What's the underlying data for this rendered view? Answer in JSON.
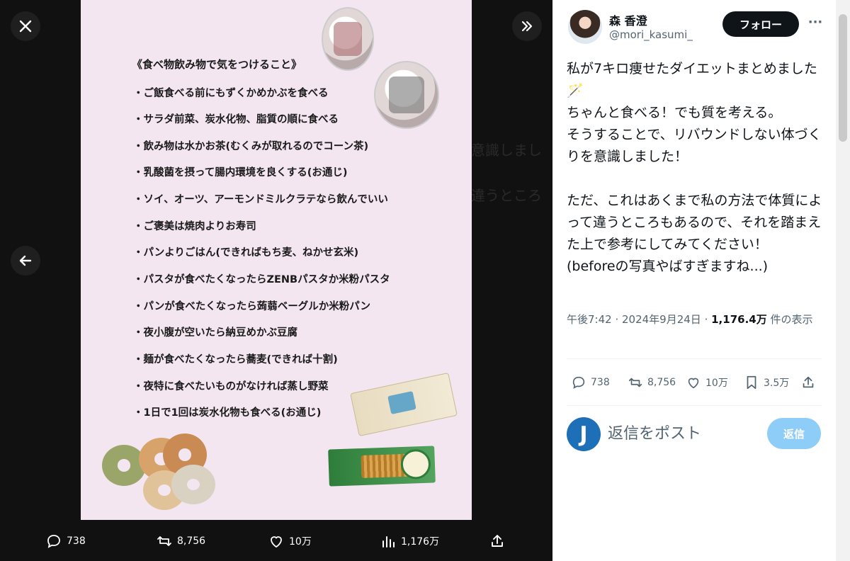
{
  "viewer": {
    "close_icon": "close-icon",
    "expand_icon": "double-chevron-right-icon",
    "prev_icon": "arrow-left-icon",
    "background_ghost": [
      "意識しまし",
      "違うところ"
    ],
    "media": {
      "heading": "《食べ物飲み物で気をつけること》",
      "tips": [
        "・ご飯食べる前にもずくかめかぶを食べる",
        "・サラダ前菜、炭水化物、脂質の順に食べる",
        "・飲み物は水かお茶(むくみが取れるのでコーン茶)",
        "・乳酸菌を摂って腸内環境を良くする(お通じ)",
        "・ソイ、オーツ、アーモンドミルクラテなら飲んでいい",
        "・ご褒美は焼肉よりお寿司",
        "・パンよりごはん(できればもち麦、ねかせ玄米)",
        "・パスタが食べたくなったらZENBパスタか米粉パスタ",
        "・パンが食べたくなったら蒟蒻ベーグルか米粉パン",
        "・夜小腹が空いたら納豆めかぶ豆腐",
        "・麺が食べたくなったら蕎麦(できれば十割)",
        "・夜特に食べたいものがなければ蒸し野菜",
        "・1日で1回は炭水化物も食べる(お通じ)"
      ]
    },
    "bottom_bar": {
      "reply_count": "738",
      "retweet_count": "8,756",
      "like_count": "10万",
      "view_count": "1,176万"
    }
  },
  "tweet": {
    "display_name": "森 香澄",
    "handle": "@mori_kasumi_",
    "follow_label": "フォロー",
    "more_label": "···",
    "paragraphs": [
      "私が7キロ痩せたダイエットまとめました🪄\nちゃんと食べる！でも質を考える。\nそうすることで、リバウンドしない体づくりを意識しました！",
      "ただ、これはあくまで私の方法で体質によって違うところもあるので、それを踏まえた上で参考にしてみてください！\n(beforeの写真やばすぎますね...)"
    ],
    "meta": {
      "time": "午後7:42",
      "sep1": " · ",
      "date": "2024年9月24日",
      "sep2": " · ",
      "views": "1,176.4万",
      "views_suffix": " 件の表示"
    },
    "actions": {
      "reply": "738",
      "retweet": "8,756",
      "like": "10万",
      "bookmark": "3.5万"
    },
    "reply_box": {
      "avatar_letter": "J",
      "placeholder": "返信をポスト",
      "button": "返信"
    }
  }
}
